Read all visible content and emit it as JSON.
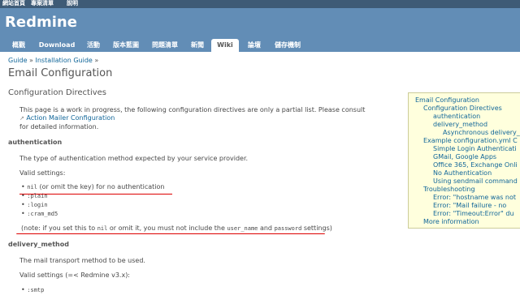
{
  "top_menu": {
    "items": [
      "網站首頁",
      "專案清單",
      "說明"
    ]
  },
  "header": {
    "title": "Redmine"
  },
  "main_menu": {
    "tabs": [
      {
        "label": "概觀"
      },
      {
        "label": "Download"
      },
      {
        "label": "活動"
      },
      {
        "label": "版本藍圖"
      },
      {
        "label": "問題清單"
      },
      {
        "label": "新聞"
      },
      {
        "label": "Wiki",
        "selected": true
      },
      {
        "label": "論壇"
      },
      {
        "label": "儲存機制"
      }
    ]
  },
  "breadcrumb": {
    "items": [
      "Guide",
      "Installation Guide"
    ],
    "separator": "»"
  },
  "page": {
    "title": "Email Configuration",
    "section_title": "Configuration Directives",
    "intro": "This page is a work in progress, the following configuration directives are only a partial list. Please consult",
    "intro_link": "Action Mailer Configuration",
    "intro_tail": "for detailed information.",
    "auth_heading": "authentication",
    "auth_desc": "The type of authentication method expected by your service provider.",
    "valid_settings": "Valid settings:",
    "auth_options": [
      {
        "code": "nil",
        "text": "(or omit the key) for no authentication"
      },
      {
        "code": ":plain",
        "text": ""
      },
      {
        "code": ":login",
        "text": ""
      },
      {
        "code": ":cram_md5",
        "text": ""
      }
    ],
    "note": {
      "pre": "(note: if you set this to",
      "code1": "nil",
      "mid": "or omit it, you must not include the",
      "code2": "user_name",
      "and": "and",
      "code3": "password",
      "post": "settings)"
    },
    "delivery_heading": "delivery_method",
    "delivery_desc": "The mail transport method to be used.",
    "delivery_valid": "Valid settings (=< Redmine v3.x):",
    "delivery_options": [
      {
        "code": ":smtp"
      }
    ]
  },
  "toc": {
    "items": [
      {
        "label": "Email Configuration",
        "level": 0
      },
      {
        "label": "Configuration Directives",
        "level": 1
      },
      {
        "label": "authentication",
        "level": 2
      },
      {
        "label": "delivery_method",
        "level": 2
      },
      {
        "label": "Asynchronous delivery_",
        "level": 3
      },
      {
        "label": "Example configuration.yml C",
        "level": 1
      },
      {
        "label": "Simple Login Authenticati",
        "level": 2
      },
      {
        "label": "GMail, Google Apps",
        "level": 2
      },
      {
        "label": "Office 365, Exchange Onli",
        "level": 2
      },
      {
        "label": "No Authentication",
        "level": 2
      },
      {
        "label": "Using sendmail command",
        "level": 2
      },
      {
        "label": "Troubleshooting",
        "level": 1
      },
      {
        "label": "Error: \"hostname was not",
        "level": 2
      },
      {
        "label": "Error: \"Mail failure - no",
        "level": 2
      },
      {
        "label": "Error: \"Timeout:Error\" du",
        "level": 2
      },
      {
        "label": "More information",
        "level": 1
      }
    ]
  },
  "colors": {
    "top_bar": "#3E5B76",
    "header": "#628DB6",
    "link": "#116699",
    "toc_bg": "#FFFFDD",
    "annotation": "#DD0000"
  }
}
